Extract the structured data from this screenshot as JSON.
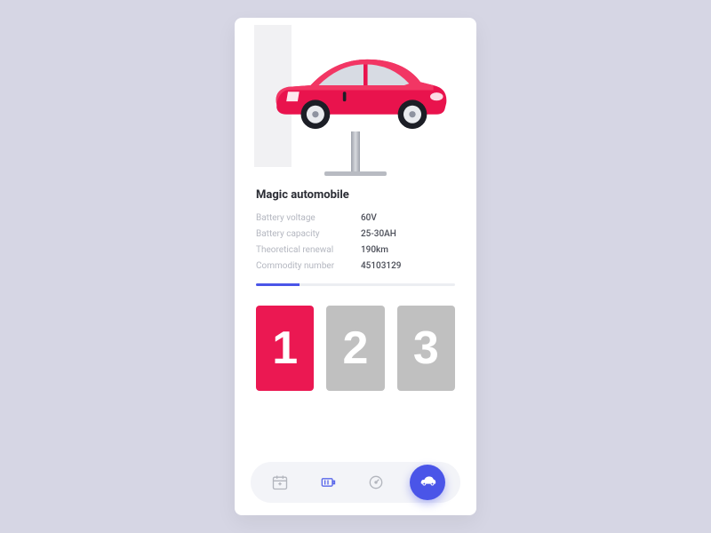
{
  "product": {
    "title": "Magic automobile",
    "specs": [
      {
        "label": "Battery voltage",
        "value": "60V"
      },
      {
        "label": "Battery capacity",
        "value": "25-30AH"
      },
      {
        "label": "Theoretical renewal",
        "value": "190km"
      },
      {
        "label": "Commodity number",
        "value": "45103129"
      }
    ],
    "progress_pct": 22
  },
  "cards": [
    "1",
    "2",
    "3"
  ],
  "tabbar": {
    "items": [
      {
        "name": "calendar-icon",
        "active": false
      },
      {
        "name": "battery-icon",
        "active": true
      },
      {
        "name": "speedometer-icon",
        "active": false
      }
    ],
    "fab": {
      "name": "car-icon"
    }
  },
  "colors": {
    "accent": "#4a55e8",
    "danger": "#eb1852"
  }
}
